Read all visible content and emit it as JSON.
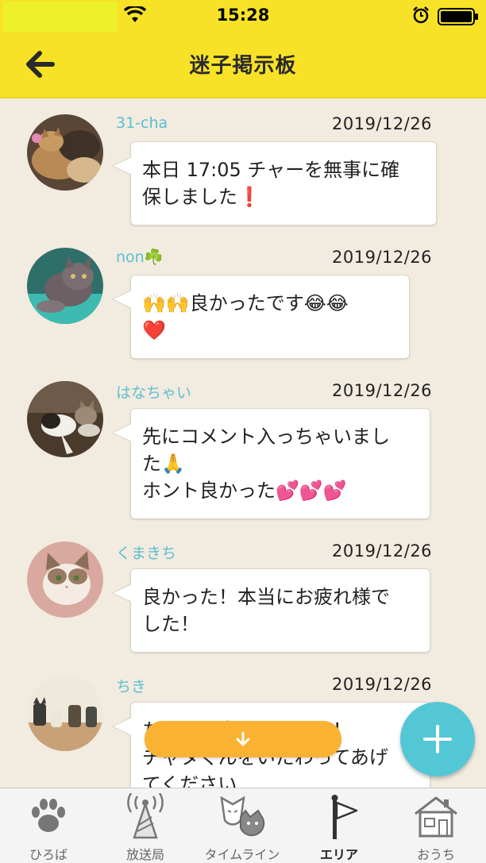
{
  "status_bar": {
    "time": "15:28"
  },
  "header": {
    "title": "迷子掲示板"
  },
  "posts": [
    {
      "username": "31-cha",
      "date": "2019/12/26",
      "message": "本日 17:05 チャーを無事に確\n保しました❗"
    },
    {
      "username": "non☘️",
      "date": "2019/12/26",
      "message": "🙌🙌良かったです😂😂\n❤️"
    },
    {
      "username": "はなちゃい",
      "date": "2019/12/26",
      "message": "先にコメント入っちゃいまし\nた🙏\nホント良かった💕💕💕"
    },
    {
      "username": "くまきち",
      "date": "2019/12/26",
      "message": "良かった！本当にお疲れ様で\nした！"
    },
    {
      "username": "ちき",
      "date": "2019/12/26",
      "message": "ちゃー、良かったです！\nチャタくんをいたわってあげ\nてください"
    }
  ],
  "tabbar": {
    "items": [
      {
        "label": "ひろば",
        "icon": "paw-icon"
      },
      {
        "label": "放送局",
        "icon": "broadcast-tower-icon"
      },
      {
        "label": "タイムライン",
        "icon": "cat-faces-icon"
      },
      {
        "label": "エリア",
        "icon": "flag-icon"
      },
      {
        "label": "おうち",
        "icon": "house-icon"
      }
    ],
    "active": "エリア"
  },
  "colors": {
    "header": "#f8e227",
    "accent_cyan": "#54c7d6",
    "scroll_button": "#f9b232",
    "username": "#5bbfd0",
    "background": "#f2ebe0"
  }
}
